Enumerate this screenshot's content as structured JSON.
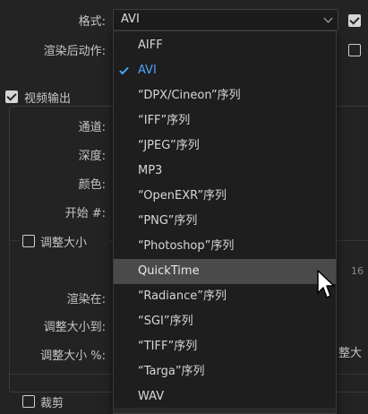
{
  "panel": {
    "format_label": "格式:",
    "format_value": "AVI",
    "post_render_label": "渲染后动作:",
    "video_output_label": "视频输出",
    "channel_label": "通道:",
    "depth_label": "深度:",
    "color_label": "颜色:",
    "start_label": "开始 #:",
    "resize_label": "调整大小",
    "render_at_label": "渲染在:",
    "resize_to_label": "调整大小到:",
    "resize_pct_label": "调整大小 %:",
    "partial_right_1": "16",
    "partial_right_2": "整大",
    "crop_label": "裁剪"
  },
  "dropdown": {
    "items": [
      {
        "label": "AIFF"
      },
      {
        "label": "AVI",
        "selected": true
      },
      {
        "label": "“DPX/Cineon”序列"
      },
      {
        "label": "“IFF”序列"
      },
      {
        "label": "“JPEG”序列"
      },
      {
        "label": "MP3"
      },
      {
        "label": "“OpenEXR”序列"
      },
      {
        "label": "“PNG”序列"
      },
      {
        "label": "“Photoshop”序列"
      },
      {
        "label": "QuickTime",
        "hover": true
      },
      {
        "label": "“Radiance”序列"
      },
      {
        "label": "“SGI”序列"
      },
      {
        "label": "“TIFF”序列"
      },
      {
        "label": "“Targa”序列"
      },
      {
        "label": "WAV"
      }
    ]
  },
  "icons": {
    "tick": "checkmark-icon",
    "chevron": "chevron-down-icon",
    "cursor": "mouse-pointer-icon"
  },
  "colors": {
    "background": "#232323",
    "menu_background": "#1e1e1e",
    "selected_text": "#4fa1ff",
    "hover_background": "#4a4a4a"
  }
}
